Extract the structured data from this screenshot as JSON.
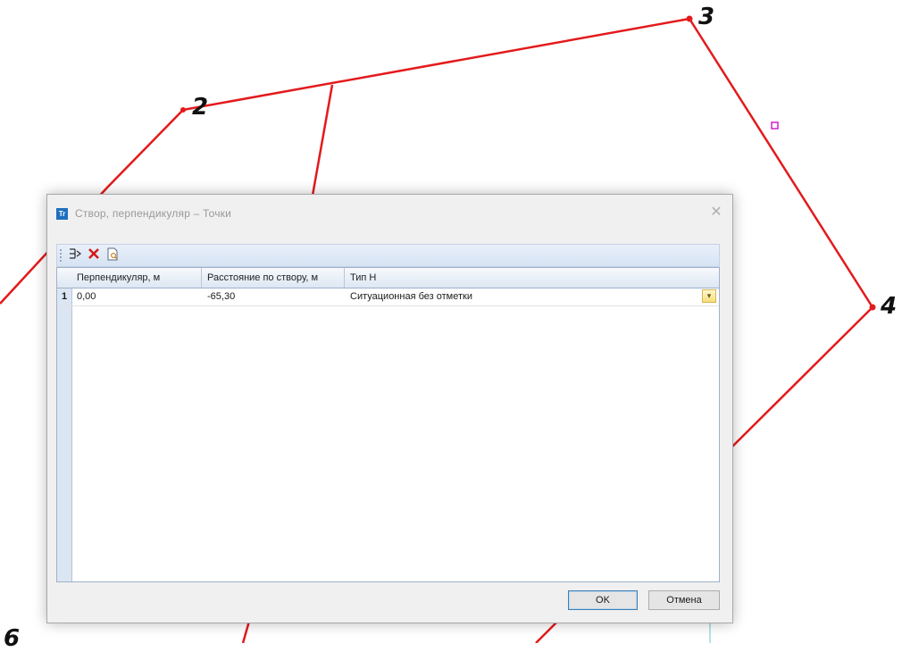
{
  "background": {
    "point_labels": [
      "2",
      "3",
      "4",
      "6"
    ],
    "line_color": "#e31a1c",
    "marker_color": "#d020d0"
  },
  "dialog": {
    "app_icon_text": "Tr",
    "title": "Створ, перпендикуляр – Точки",
    "close_glyph": "✕",
    "toolbar": {
      "insert_icon": "insert-row-icon",
      "delete_icon": "delete-icon",
      "preview_icon": "preview-icon"
    },
    "table": {
      "columns": [
        "Перпендикуляр, м",
        "Расстояние по створу, м",
        "Тип Н"
      ],
      "rows": [
        {
          "num": "1",
          "perpendicular": "0,00",
          "distance": "-65,30",
          "type": "Ситуационная без отметки"
        }
      ]
    },
    "ok_label": "OK",
    "cancel_label": "Отмена"
  }
}
